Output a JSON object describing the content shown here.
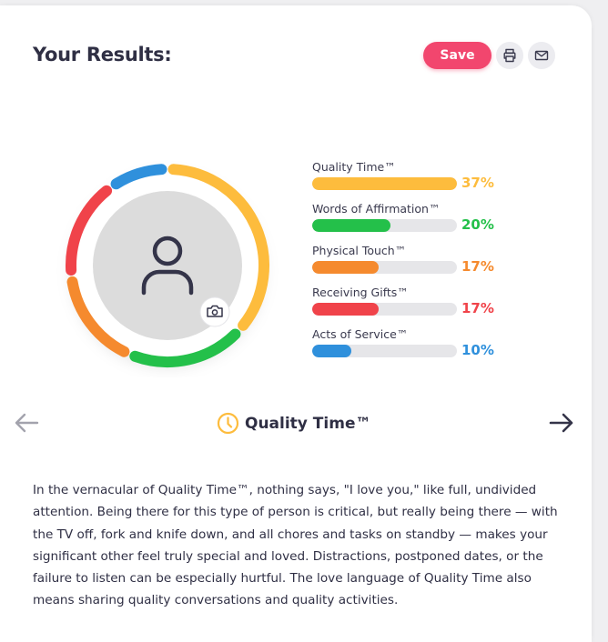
{
  "header": {
    "title": "Your Results:",
    "save_label": "Save",
    "print_icon": "printer-icon",
    "mail_icon": "mail-icon"
  },
  "avatar": {
    "icon": "person-icon",
    "camera_icon": "camera-icon"
  },
  "results": [
    {
      "label": "Quality Time™",
      "percent": "37%",
      "value": 37,
      "color": "#fdbc3d"
    },
    {
      "label": "Words of Affirmation™",
      "percent": "20%",
      "value": 20,
      "color": "#24c04a"
    },
    {
      "label": "Physical Touch™",
      "percent": "17%",
      "value": 17,
      "color": "#f58a2e"
    },
    {
      "label": "Receiving Gifts™",
      "percent": "17%",
      "value": 17,
      "color": "#f0434a"
    },
    {
      "label": "Acts of Service™",
      "percent": "10%",
      "value": 10,
      "color": "#2f90dc"
    }
  ],
  "carousel": {
    "prev_icon": "arrow-left-icon",
    "next_icon": "arrow-right-icon",
    "current_icon": "clock-icon",
    "current_title": "Quality Time™"
  },
  "description": "In the vernacular of Quality Time™, nothing says, \"I love you,\" like full, undivided attention. Being there for this type of person is critical, but really being there — with the TV off, fork and knife down, and all chores and tasks on standby — makes your significant other feel truly special and loved. Distractions, postponed dates, or the failure to listen can be especially hurtful. The love language of Quality Time also means sharing quality conversations and quality activities."
}
